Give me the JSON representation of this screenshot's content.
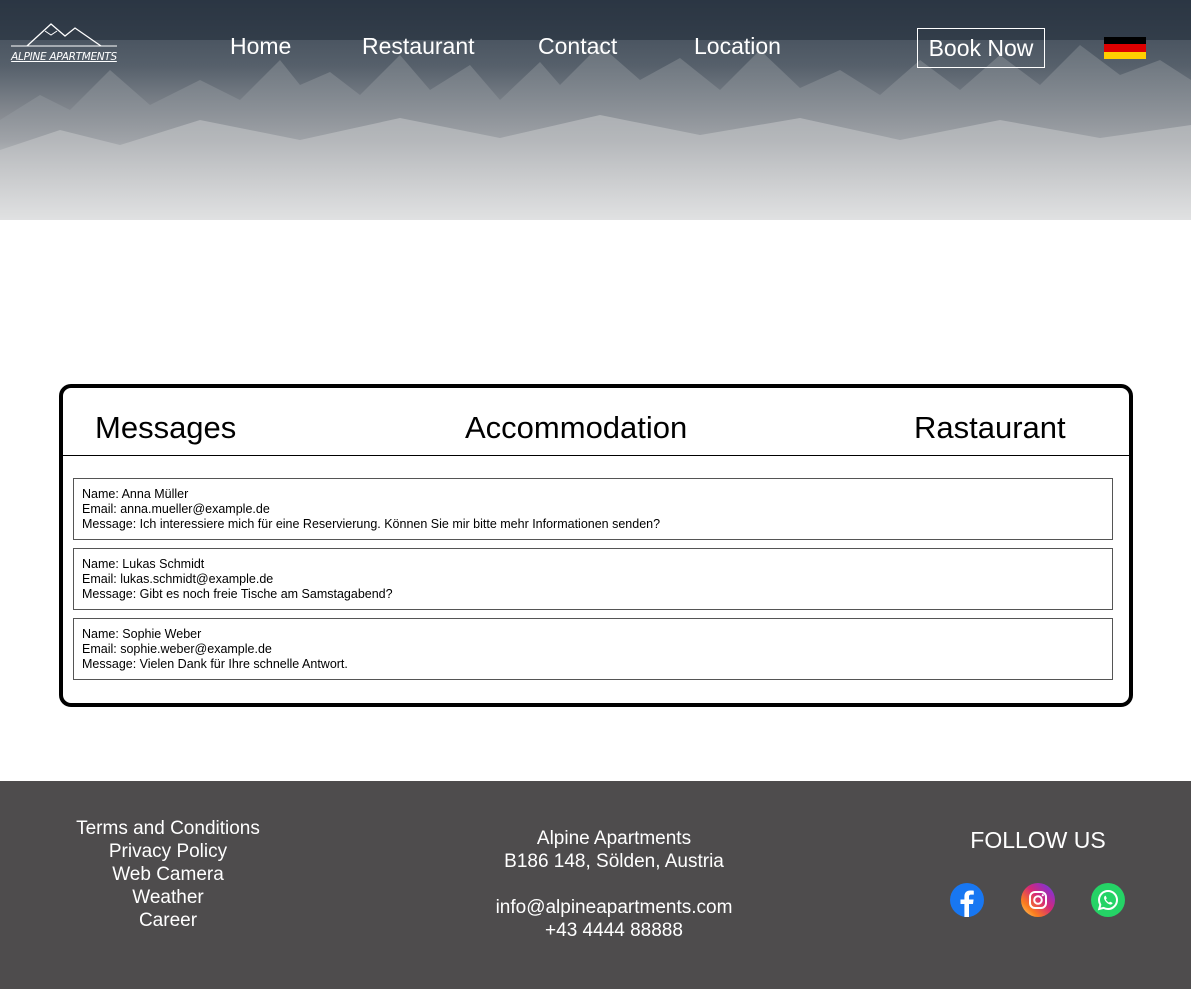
{
  "brand": {
    "logo_text": "ALPINE APARTMENTS"
  },
  "nav": {
    "items": [
      "Home",
      "Restaurant",
      "Contact",
      "Location"
    ],
    "book_now": "Book Now",
    "language_flag": "german-flag-icon"
  },
  "panel": {
    "tabs": [
      "Messages",
      "Accommodation",
      "Rastaurant"
    ],
    "messages": [
      {
        "name": "Name: Anna Müller",
        "email": "Email: anna.mueller@example.de",
        "message": "Message: Ich interessiere mich für eine Reservierung. Können Sie mir bitte mehr Informationen senden?"
      },
      {
        "name": "Name: Lukas Schmidt",
        "email": "Email: lukas.schmidt@example.de",
        "message": "Message: Gibt es noch freie Tische am Samstagabend?"
      },
      {
        "name": "Name: Sophie Weber",
        "email": "Email: sophie.weber@example.de",
        "message": "Message: Vielen Dank für Ihre schnelle Antwort."
      }
    ]
  },
  "footer": {
    "links": [
      "Terms and Conditions",
      "Privacy Policy",
      "Web Camera",
      "Weather",
      "Career"
    ],
    "company": "Alpine Apartments",
    "address": "B186 148, Sölden, Austria",
    "email": "info@alpineapartments.com",
    "phone": "+43 4444 88888",
    "follow_label": "FOLLOW US",
    "social": [
      "facebook-icon",
      "instagram-icon",
      "whatsapp-icon"
    ]
  },
  "colors": {
    "footer_bg": "#4e4c4d",
    "facebook": "#1877f2",
    "whatsapp": "#25d366",
    "flag": [
      "#000000",
      "#dd0000",
      "#ffce00"
    ]
  }
}
